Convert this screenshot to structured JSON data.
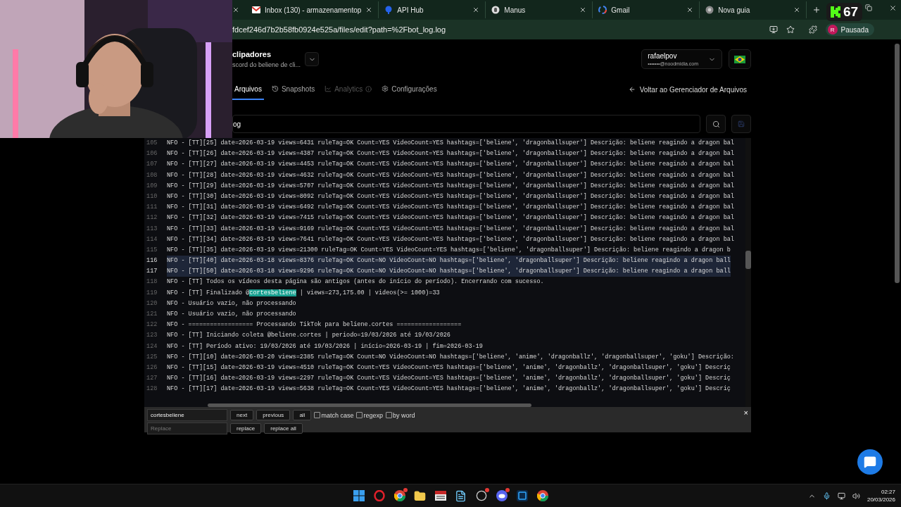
{
  "browser": {
    "tabs": [
      {
        "title": "Inbox (130) - armazenamentop",
        "kind": "mail",
        "selected": false
      },
      {
        "title": "API Hub",
        "kind": "hub",
        "selected": false
      },
      {
        "title": "Manus",
        "kind": "hand",
        "selected": false
      },
      {
        "title": "Gmail",
        "kind": "google",
        "selected": false
      },
      {
        "title": "Nova guia",
        "kind": "chrome",
        "selected": false
      }
    ],
    "viewer_count": "67",
    "url": "fdcef246d7b2b58fb0924e525a/files/edit?path=%2Fbot_log.log",
    "profile": {
      "initial": "R",
      "status": "Pausada"
    }
  },
  "project": {
    "name": "clipadores",
    "subtitle": "scord do beliene de cli..."
  },
  "account": {
    "user": "rafaelpov",
    "email": "•••••••@noodmidia.com"
  },
  "nav": {
    "tabs": [
      {
        "label": "Arquivos",
        "kind": "plain",
        "selected": true,
        "disabled": false
      },
      {
        "label": "Snapshots",
        "kind": "history",
        "selected": false,
        "disabled": false
      },
      {
        "label": "Analytics",
        "kind": "chart",
        "selected": false,
        "disabled": true
      },
      {
        "label": "Configurações",
        "kind": "gear",
        "selected": false,
        "disabled": false
      }
    ],
    "back": "Voltar ao Gerenciador de Arquivos"
  },
  "file_field": {
    "value": "og"
  },
  "save_disabled": true,
  "editor": {
    "lines": [
      {
        "number": "105",
        "selected": false,
        "text": "NFO - [TT][25] date=2026-03-19 views=6431 ruleTag=OK Count=YES VideoCount=YES hashtags=['beliene', 'dragonballsuper'] Descrição: beliene reagindo a dragon bal"
      },
      {
        "number": "106",
        "selected": false,
        "text": "NFO - [TT][26] date=2026-03-19 views=4387 ruleTag=OK Count=YES VideoCount=YES hashtags=['beliene', 'dragonballsuper'] Descrição: beliene reagindo a dragon bal"
      },
      {
        "number": "107",
        "selected": false,
        "text": "NFO - [TT][27] date=2026-03-19 views=4453 ruleTag=OK Count=YES VideoCount=YES hashtags=['beliene', 'dragonballsuper'] Descrição: beliene reagindo a dragon bal"
      },
      {
        "number": "108",
        "selected": false,
        "text": "NFO - [TT][28] date=2026-03-19 views=4632 ruleTag=OK Count=YES VideoCount=YES hashtags=['beliene', 'dragonballsuper'] Descrição: beliene reagindo a dragon bal"
      },
      {
        "number": "109",
        "selected": false,
        "text": "NFO - [TT][29] date=2026-03-19 views=5707 ruleTag=OK Count=YES VideoCount=YES hashtags=['beliene', 'dragonballsuper'] Descrição: beliene reagindo a dragon bal"
      },
      {
        "number": "110",
        "selected": false,
        "text": "NFO - [TT][30] date=2026-03-19 views=8092 ruleTag=OK Count=YES VideoCount=YES hashtags=['beliene', 'dragonballsuper'] Descrição: beliene reagindo a dragon bal"
      },
      {
        "number": "111",
        "selected": false,
        "text": "NFO - [TT][31] date=2026-03-19 views=6492 ruleTag=OK Count=YES VideoCount=YES hashtags=['beliene', 'dragonballsuper'] Descrição: beliene reagindo a dragon bal"
      },
      {
        "number": "112",
        "selected": false,
        "text": "NFO - [TT][32] date=2026-03-19 views=7415 ruleTag=OK Count=YES VideoCount=YES hashtags=['beliene', 'dragonballsuper'] Descrição: beliene reagindo a dragon bal"
      },
      {
        "number": "113",
        "selected": false,
        "text": "NFO - [TT][33] date=2026-03-19 views=9169 ruleTag=OK Count=YES VideoCount=YES hashtags=['beliene', 'dragonballsuper'] Descrição: beliene reagindo a dragon bal"
      },
      {
        "number": "114",
        "selected": false,
        "text": "NFO - [TT][34] date=2026-03-19 views=7641 ruleTag=OK Count=YES VideoCount=YES hashtags=['beliene', 'dragonballsuper'] Descrição: beliene reagindo a dragon bal"
      },
      {
        "number": "115",
        "selected": false,
        "text": "NFO - [TT][35] date=2026-03-19 views=21300 ruleTag=OK Count=YES VideoCount=YES hashtags=['beliene', 'dragonballsuper'] Descrição: beliene reagindo a dragon b"
      },
      {
        "number": "116",
        "selected": true,
        "text": "NFO - [TT][40] date=2026-03-18 views=8376 ruleTag=OK Count=NO VideoCount=NO hashtags=['beliene', 'dragonballsuper'] Descrição: beliene reagindo a dragon ball"
      },
      {
        "number": "117",
        "selected": true,
        "text": "NFO - [TT][50] date=2026-03-18 views=9296 ruleTag=OK Count=NO VideoCount=NO hashtags=['beliene', 'dragonballsuper'] Descrição: beliene reagindo a dragon ball"
      },
      {
        "number": "118",
        "selected": false,
        "text": "NFO - [TT] Todos os vídeos desta página são antigos (antes do início do período). Encerrando com sucesso."
      },
      {
        "number": "119",
        "selected": false,
        "before": "NFO - [TT] Finalizado @",
        "match": "cortesbeliene",
        "after": " | views=273,175.00 | videos(>= 1000)=33"
      },
      {
        "number": "120",
        "selected": false,
        "text": "NFO - Usuário vazio, não processando"
      },
      {
        "number": "121",
        "selected": false,
        "text": "NFO - Usuário vazio, não processando"
      },
      {
        "number": "122",
        "selected": false,
        "text": "NFO - ================== Processando TikTok para beliene.cortes =================="
      },
      {
        "number": "123",
        "selected": false,
        "text": "NFO - [TT] Iniciando coleta @beliene.cortes | periodo=19/03/2026 até 19/03/2026"
      },
      {
        "number": "124",
        "selected": false,
        "text": "NFO - [TT] Período ativo: 19/03/2026 até 19/03/2026 | início=2026-03-19 | fim=2026-03-19"
      },
      {
        "number": "125",
        "selected": false,
        "text": "NFO - [TT][10] date=2026-03-20 views=2385 ruleTag=OK Count=NO VideoCount=NO hashtags=['beliene', 'anime', 'dragonballz', 'dragonballsuper', 'goku'] Descrição:"
      },
      {
        "number": "126",
        "selected": false,
        "text": "NFO - [TT][15] date=2026-03-19 views=4510 ruleTag=OK Count=YES VideoCount=YES hashtags=['beliene', 'anime', 'dragonballz', 'dragonballsuper', 'goku'] Descriç"
      },
      {
        "number": "127",
        "selected": false,
        "text": "NFO - [TT][16] date=2026-03-19 views=2297 ruleTag=OK Count=YES VideoCount=YES hashtags=['beliene', 'anime', 'dragonballz', 'dragonballsuper', 'goku'] Descriç"
      },
      {
        "number": "128",
        "selected": false,
        "text": "NFO - [TT][17] date=2026-03-19 views=5638 ruleTag=OK Count=YES VideoCount=YES hashtags=['beliene', 'anime', 'dragonballz', 'dragonballsuper', 'goku'] Descriç"
      }
    ]
  },
  "find_bar": {
    "search_value": "cortesbeliene",
    "replace_placeholder": "Replace",
    "buttons": [
      "next",
      "previous",
      "all"
    ],
    "options": [
      {
        "label": "match case",
        "checked": false
      },
      {
        "label": "regexp",
        "checked": false
      },
      {
        "label": "by word",
        "checked": false
      }
    ],
    "replace_buttons": [
      "replace",
      "replace all"
    ],
    "close": "×"
  },
  "taskbar": {
    "apps": [
      {
        "kind": "windows",
        "badge": false
      },
      {
        "kind": "opera",
        "badge": false
      },
      {
        "kind": "chrome",
        "badge": true
      },
      {
        "kind": "folder",
        "badge": false
      },
      {
        "kind": "news",
        "badge": false
      },
      {
        "kind": "notepad",
        "badge": false
      },
      {
        "kind": "tool",
        "badge": true
      },
      {
        "kind": "discord",
        "badge": true
      },
      {
        "kind": "photoshop",
        "badge": false
      },
      {
        "kind": "chrome",
        "badge": false
      }
    ],
    "time": "02:27",
    "date": "20/03/2026"
  }
}
